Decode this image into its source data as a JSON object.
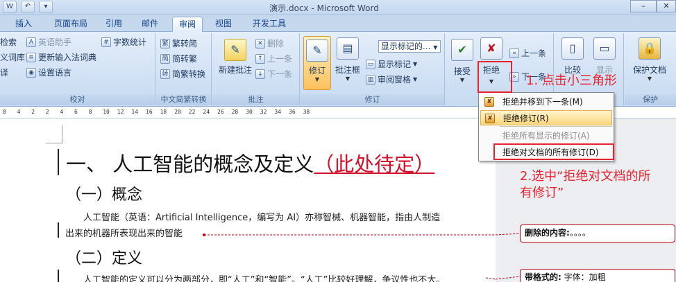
{
  "window": {
    "title": "演示.docx - Microsoft Word",
    "quick_access": [
      "W",
      "↶",
      "▾"
    ],
    "controls": [
      "–",
      "✕"
    ]
  },
  "tabs": [
    "插入",
    "页面布局",
    "引用",
    "邮件",
    "审阅",
    "视图",
    "开发工具"
  ],
  "active_tab": "审阅",
  "ribbon": {
    "proofing": {
      "label": "校对",
      "items": [
        "检索",
        "英语助手",
        "字数统计",
        "义词库",
        "更新输入法词典",
        "译",
        "设置语言"
      ]
    },
    "chinese_conversion": {
      "label": "中文简繁转换",
      "items": [
        "繁转简",
        "简转繁",
        "简繁转换"
      ]
    },
    "comments": {
      "label": "批注",
      "new_comment": "新建批注",
      "delete": "删除",
      "previous": "上一条",
      "next": "下一条"
    },
    "tracking": {
      "label": "修订",
      "track_changes": "修订",
      "balloons": "批注框",
      "display_combo": "显示标记的...",
      "show_markup": "显示标记",
      "reviewing_pane": "审阅窗格"
    },
    "changes": {
      "accept": "接受",
      "reject": "拒绝",
      "previous": "上一条",
      "next": "下一条"
    },
    "compare": {
      "compare": "比较",
      "show_source": "显示"
    },
    "protect": {
      "label": "保护",
      "protect_document": "保护文档"
    }
  },
  "ruler": [
    "8",
    "4",
    "2",
    "2",
    "4",
    "6",
    "8",
    "10",
    "12",
    "14",
    "16",
    "18",
    "20",
    "22",
    "24",
    "26",
    "28",
    "30",
    "32",
    "34",
    "36",
    "38"
  ],
  "reject_menu": {
    "items": [
      {
        "label": "拒绝并移到下一条(M)",
        "state": "normal"
      },
      {
        "label": "拒绝修订(R)",
        "state": "highlighted"
      },
      {
        "label": "拒绝所有显示的修订(A)",
        "state": "disabled"
      },
      {
        "label": "拒绝对文档的所有修订(D)",
        "state": "normal"
      }
    ]
  },
  "document": {
    "heading1_text": "一、  人工智能的概念及定义",
    "heading1_inserted": "（此处待定）",
    "heading2_a": "（一）概念",
    "para1_line1": "人工智能（英语：Artificial Intelligence，编写为 AI）亦称智械、机器智能，指由人制造",
    "para1_line2": "出来的机器所表现出来的智能",
    "heading2_b": "（二）定义",
    "para2_line1": "人工智能的定义可以分为两部分，即“人工”和“智能”。“人工”比较好理解，争议性也不大。"
  },
  "markup_balloons": [
    {
      "label": "删除的内容:",
      "text": "。。。。"
    },
    {
      "label": "带格式的:",
      "text": "字体：加粗"
    }
  ],
  "annotations": {
    "step1": "1. 点击小三角形",
    "step2_line1": "2.选中“拒绝对文档的所",
    "step2_line2": "有修订”"
  },
  "colors": {
    "annotation_red": "#e8222e",
    "revision_red": "#d5102a",
    "menu_highlight": "#fcd67c"
  }
}
